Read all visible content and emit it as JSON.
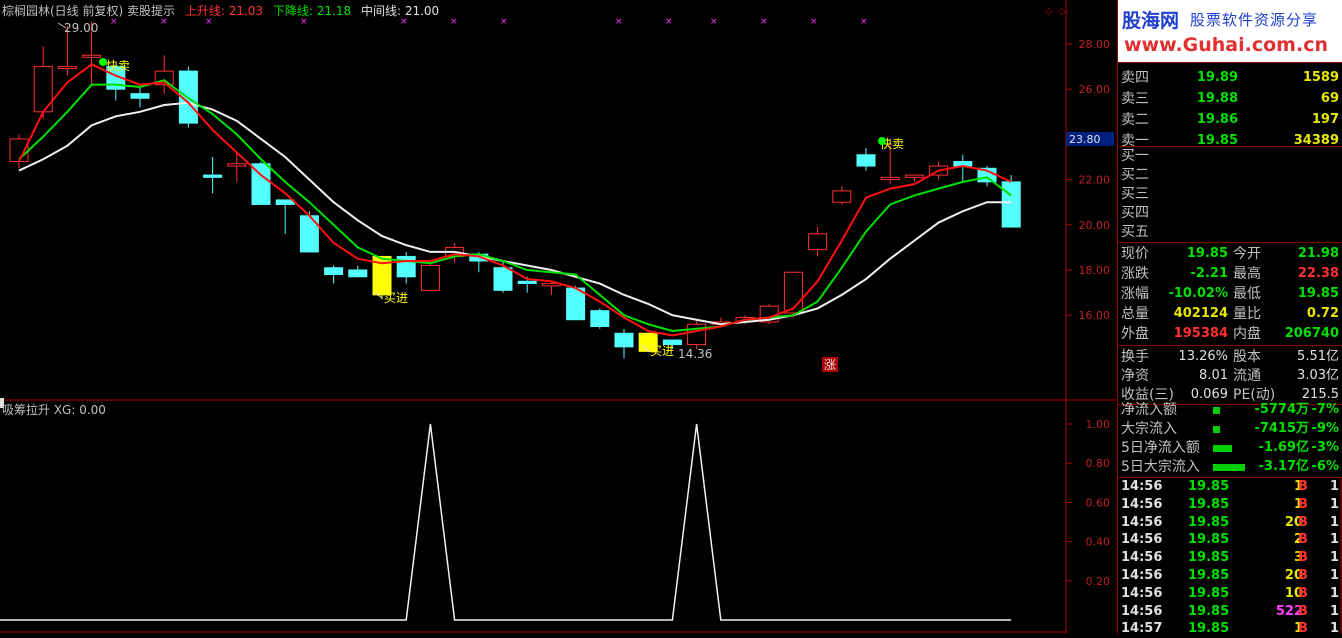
{
  "header": {
    "stock_name": "棕榈园林(日线 前复权) 卖股提示",
    "up_line_label": "上升线:",
    "up_line_value": "21.03",
    "down_line_label": "下降线:",
    "down_line_value": "21.18",
    "mid_line_label": "中间线:",
    "mid_line_value": "21.00"
  },
  "sub_header": {
    "label": "吸筹拉升 XG: 0.00"
  },
  "annotations": {
    "sell1": "快卖",
    "sell2": "快卖",
    "buy1": "买进",
    "buy2": "买进",
    "high_label": "29.00",
    "low_label": "14.36",
    "limit_badge": "涨",
    "current_price_tag": "23.80"
  },
  "axis": {
    "main_ticks": [
      "28.00",
      "26.00",
      "24.00",
      "22.00",
      "20.00",
      "18.00",
      "16.00"
    ],
    "sub_ticks": [
      "1.00",
      "0.80",
      "0.60",
      "0.40",
      "0.20"
    ]
  },
  "colors": {
    "up": "#ff3030",
    "down": "#54ffff",
    "up_line": "#ff1010",
    "down_line": "#00e000",
    "mid_line": "#f0f0f0",
    "axis_red": "#b00000",
    "highlight": "#ffff00"
  },
  "candles": [
    {
      "o": 22.8,
      "c": 23.8,
      "h": 24.0,
      "l": 22.5
    },
    {
      "o": 25.0,
      "c": 27.0,
      "h": 27.9,
      "l": 24.7
    },
    {
      "o": 27.0,
      "c": 27.0,
      "h": 28.8,
      "l": 26.6
    },
    {
      "o": 27.5,
      "c": 27.5,
      "h": 29.0,
      "l": 26.2
    },
    {
      "o": 27.0,
      "c": 26.0,
      "h": 27.0,
      "l": 25.5
    },
    {
      "o": 25.8,
      "c": 25.6,
      "h": 26.2,
      "l": 25.2
    },
    {
      "o": 26.2,
      "c": 26.8,
      "h": 27.5,
      "l": 25.8
    },
    {
      "o": 26.8,
      "c": 24.5,
      "h": 27.0,
      "l": 24.3
    },
    {
      "o": 22.2,
      "c": 22.1,
      "h": 23.0,
      "l": 21.4
    },
    {
      "o": 22.6,
      "c": 22.7,
      "h": 23.2,
      "l": 21.9
    },
    {
      "o": 22.7,
      "c": 20.9,
      "h": 22.8,
      "l": 20.9
    },
    {
      "o": 21.1,
      "c": 20.9,
      "h": 21.1,
      "l": 19.6
    },
    {
      "o": 20.4,
      "c": 18.8,
      "h": 20.6,
      "l": 18.8
    },
    {
      "o": 18.1,
      "c": 17.8,
      "h": 18.2,
      "l": 17.4
    },
    {
      "o": 18.0,
      "c": 17.7,
      "h": 18.2,
      "l": 17.7
    },
    {
      "o": 18.6,
      "c": 16.9,
      "h": 18.6,
      "l": 16.7
    },
    {
      "o": 18.6,
      "c": 17.7,
      "h": 18.8,
      "l": 17.4
    },
    {
      "o": 17.1,
      "c": 18.2,
      "h": 18.3,
      "l": 17.1
    },
    {
      "o": 18.6,
      "c": 19.0,
      "h": 19.2,
      "l": 18.3
    },
    {
      "o": 18.7,
      "c": 18.4,
      "h": 18.8,
      "l": 17.9
    },
    {
      "o": 18.1,
      "c": 17.1,
      "h": 18.4,
      "l": 17.0
    },
    {
      "o": 17.5,
      "c": 17.4,
      "h": 17.7,
      "l": 17.0
    },
    {
      "o": 17.3,
      "c": 17.4,
      "h": 17.5,
      "l": 16.9
    },
    {
      "o": 17.2,
      "c": 15.8,
      "h": 17.3,
      "l": 15.8
    },
    {
      "o": 16.2,
      "c": 15.5,
      "h": 16.3,
      "l": 15.4
    },
    {
      "o": 15.2,
      "c": 14.6,
      "h": 15.4,
      "l": 14.1
    },
    {
      "o": 15.2,
      "c": 14.4,
      "h": 15.2,
      "l": 14.4
    },
    {
      "o": 14.9,
      "c": 14.7,
      "h": 14.9,
      "l": 14.5
    },
    {
      "o": 14.7,
      "c": 15.6,
      "h": 15.8,
      "l": 14.5
    },
    {
      "o": 15.6,
      "c": 15.7,
      "h": 15.9,
      "l": 15.5
    },
    {
      "o": 15.7,
      "c": 15.9,
      "h": 16.0,
      "l": 15.6
    },
    {
      "o": 15.7,
      "c": 16.4,
      "h": 16.5,
      "l": 15.6
    },
    {
      "o": 16.1,
      "c": 17.9,
      "h": 17.9,
      "l": 15.9
    },
    {
      "o": 18.9,
      "c": 19.6,
      "h": 19.9,
      "l": 18.6
    },
    {
      "o": 21.0,
      "c": 21.5,
      "h": 21.7,
      "l": 20.9
    },
    {
      "o": 23.1,
      "c": 22.6,
      "h": 23.4,
      "l": 22.4
    },
    {
      "o": 22.0,
      "c": 22.1,
      "h": 23.8,
      "l": 21.8
    },
    {
      "o": 22.1,
      "c": 22.2,
      "h": 22.2,
      "l": 21.9
    },
    {
      "o": 22.2,
      "c": 22.6,
      "h": 22.8,
      "l": 22.0
    },
    {
      "o": 22.8,
      "c": 22.6,
      "h": 23.1,
      "l": 21.9
    },
    {
      "o": 22.5,
      "c": 21.9,
      "h": 22.6,
      "l": 21.7
    },
    {
      "o": 21.9,
      "c": 19.9,
      "h": 22.2,
      "l": 19.9
    }
  ],
  "lines": {
    "up": [
      22.8,
      25.0,
      26.3,
      27.1,
      26.6,
      26.2,
      26.3,
      25.4,
      24.2,
      23.2,
      22.2,
      21.4,
      20.4,
      19.2,
      18.5,
      18.3,
      18.4,
      18.4,
      18.7,
      18.6,
      18.2,
      17.6,
      17.5,
      17.2,
      16.6,
      15.9,
      15.3,
      15.1,
      15.3,
      15.5,
      15.8,
      15.9,
      16.3,
      17.5,
      19.3,
      21.2,
      21.6,
      21.8,
      22.4,
      22.6,
      22.4,
      21.9
    ],
    "down": [
      22.9,
      23.9,
      25.0,
      26.2,
      26.2,
      26.1,
      26.4,
      25.6,
      24.9,
      24.0,
      22.9,
      21.9,
      21.0,
      20.0,
      19.0,
      18.5,
      18.4,
      18.3,
      18.6,
      18.7,
      18.4,
      18.0,
      17.9,
      17.8,
      16.9,
      16.0,
      15.6,
      15.3,
      15.4,
      15.5,
      15.8,
      15.9,
      16.0,
      16.6,
      18.1,
      19.7,
      20.9,
      21.3,
      21.6,
      21.9,
      22.1,
      21.3
    ],
    "mid": [
      22.4,
      22.9,
      23.5,
      24.4,
      24.8,
      25.0,
      25.3,
      25.4,
      25.1,
      24.6,
      23.8,
      23.0,
      22.0,
      21.0,
      20.2,
      19.5,
      19.1,
      18.8,
      18.8,
      18.6,
      18.4,
      18.2,
      18.0,
      17.7,
      17.4,
      16.9,
      16.5,
      16.0,
      15.8,
      15.6,
      15.7,
      15.8,
      16.0,
      16.3,
      16.9,
      17.6,
      18.5,
      19.3,
      20.1,
      20.6,
      21.0,
      21.0
    ]
  },
  "xg_signal": [
    0,
    0,
    0,
    0,
    0,
    0,
    0,
    0,
    0,
    0,
    0,
    0,
    0,
    0,
    0,
    0,
    0,
    1,
    0,
    0,
    0,
    0,
    0,
    0,
    0,
    0,
    0,
    0,
    1,
    0,
    0,
    0,
    0,
    0,
    0,
    0,
    0,
    0,
    0,
    0,
    0,
    0
  ],
  "orderbook": {
    "sell": [
      {
        "label": "卖四",
        "price": "19.89",
        "vol": "1589"
      },
      {
        "label": "卖三",
        "price": "19.88",
        "vol": "69"
      },
      {
        "label": "卖二",
        "price": "19.86",
        "vol": "197"
      },
      {
        "label": "卖一",
        "price": "19.85",
        "vol": "34389"
      }
    ],
    "buy": [
      "买一",
      "买二",
      "买三",
      "买四",
      "买五"
    ]
  },
  "quote": [
    {
      "l1": "现价",
      "v1": "19.85",
      "l2": "今开",
      "v2": "21.98"
    },
    {
      "l1": "涨跌",
      "v1": "-2.21",
      "l2": "最高",
      "v2": "22.38"
    },
    {
      "l1": "涨幅",
      "v1": "-10.02%",
      "l2": "最低",
      "v2": "19.85"
    },
    {
      "l1": "总量",
      "v1": "402124",
      "l2": "量比",
      "v2": "0.72"
    },
    {
      "l1": "外盘",
      "v1": "195384",
      "l2": "内盘",
      "v2": "206740"
    }
  ],
  "stats": [
    {
      "l1": "换手",
      "v1": "13.26%",
      "l2": "股本",
      "v2": "5.51亿"
    },
    {
      "l1": "净资",
      "v1": "8.01",
      "l2": "流通",
      "v2": "3.03亿"
    },
    {
      "l1": "收益(三)",
      "v1": "0.069",
      "l2": "PE(动)",
      "v2": "215.5"
    }
  ],
  "flows": [
    {
      "label": "净流入额",
      "value": "-5774万",
      "pct": "-7%",
      "bar": 0.1
    },
    {
      "label": "大宗流入",
      "value": "-7415万",
      "pct": "-9%",
      "bar": 0.1
    },
    {
      "label": "5日净流入额",
      "value": "-1.69亿",
      "pct": "-3%",
      "bar": 0.55
    },
    {
      "label": "5日大宗流入",
      "value": "-3.17亿",
      "pct": "-6%",
      "bar": 1.0
    }
  ],
  "ticks": [
    {
      "time": "14:56",
      "price": "19.85",
      "vol": "1",
      "bs": "B",
      "n": "1",
      "vc": "y"
    },
    {
      "time": "14:56",
      "price": "19.85",
      "vol": "1",
      "bs": "B",
      "n": "1",
      "vc": "y"
    },
    {
      "time": "14:56",
      "price": "19.85",
      "vol": "20",
      "bs": "B",
      "n": "1",
      "vc": "y"
    },
    {
      "time": "14:56",
      "price": "19.85",
      "vol": "2",
      "bs": "B",
      "n": "1",
      "vc": "y"
    },
    {
      "time": "14:56",
      "price": "19.85",
      "vol": "3",
      "bs": "B",
      "n": "1",
      "vc": "y"
    },
    {
      "time": "14:56",
      "price": "19.85",
      "vol": "20",
      "bs": "B",
      "n": "1",
      "vc": "y"
    },
    {
      "time": "14:56",
      "price": "19.85",
      "vol": "10",
      "bs": "B",
      "n": "1",
      "vc": "y"
    },
    {
      "time": "14:56",
      "price": "19.85",
      "vol": "522",
      "bs": "B",
      "n": "1",
      "vc": "m"
    },
    {
      "time": "14:57",
      "price": "19.85",
      "vol": "1",
      "bs": "B",
      "n": "1",
      "vc": "y"
    }
  ]
}
